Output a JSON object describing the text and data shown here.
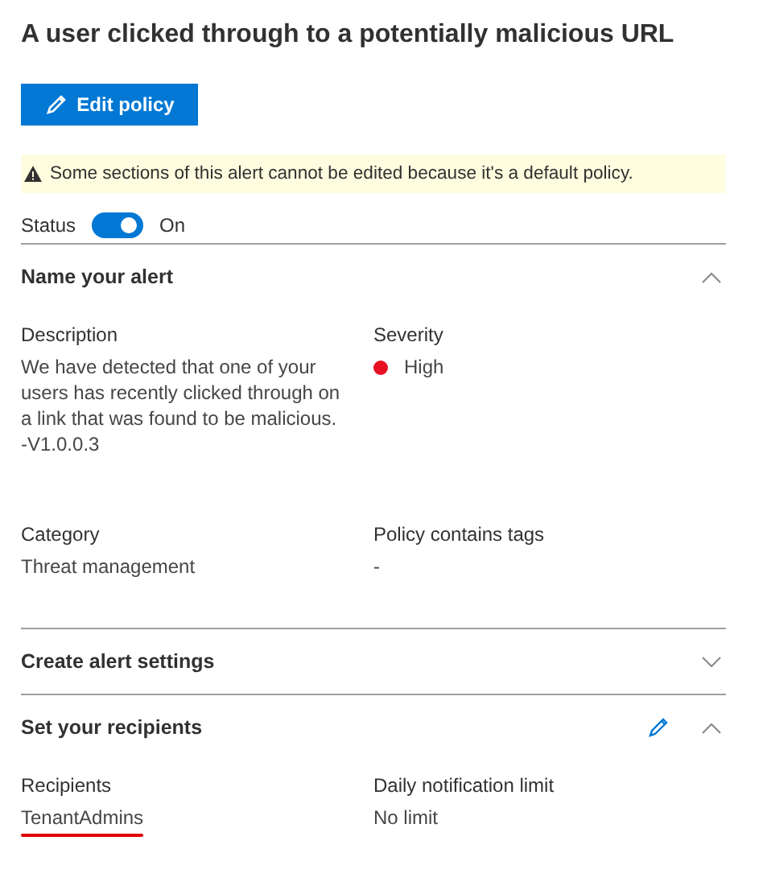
{
  "title": "A user clicked through to a potentially malicious URL",
  "edit_button": {
    "label": "Edit policy"
  },
  "warning": {
    "text": "Some sections of this alert cannot be edited because it's a default policy."
  },
  "status": {
    "label": "Status",
    "on": true,
    "value": "On"
  },
  "sections": [
    {
      "title": "Name your alert",
      "expanded": true,
      "editable": false,
      "fields": [
        {
          "label": "Description",
          "value": "We have detected that one of your users has recently clicked through on a link that was found to be malicious. -V1.0.0.3",
          "kind": "text",
          "underlined": false
        },
        {
          "label": "Severity",
          "value": "High",
          "kind": "severity",
          "color": "#e81123"
        },
        {
          "label": "Category",
          "value": "Threat management",
          "kind": "text",
          "underlined": false
        },
        {
          "label": "Policy contains tags",
          "value": "-",
          "kind": "text",
          "underlined": false
        }
      ]
    },
    {
      "title": "Create alert settings",
      "expanded": false,
      "editable": false
    },
    {
      "title": "Set your recipients",
      "expanded": true,
      "editable": true,
      "fields": [
        {
          "label": "Recipients",
          "value": "TenantAdmins",
          "kind": "text",
          "underlined": true
        },
        {
          "label": "Daily notification limit",
          "value": "No limit",
          "kind": "text",
          "underlined": false
        }
      ]
    }
  ]
}
